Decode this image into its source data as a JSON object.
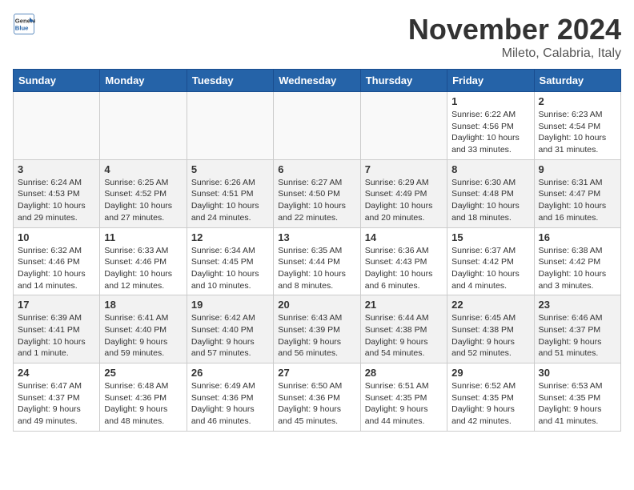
{
  "header": {
    "logo_line1": "General",
    "logo_line2": "Blue",
    "month_title": "November 2024",
    "location": "Mileto, Calabria, Italy"
  },
  "weekdays": [
    "Sunday",
    "Monday",
    "Tuesday",
    "Wednesday",
    "Thursday",
    "Friday",
    "Saturday"
  ],
  "weeks": [
    [
      {
        "day": "",
        "info": ""
      },
      {
        "day": "",
        "info": ""
      },
      {
        "day": "",
        "info": ""
      },
      {
        "day": "",
        "info": ""
      },
      {
        "day": "",
        "info": ""
      },
      {
        "day": "1",
        "info": "Sunrise: 6:22 AM\nSunset: 4:56 PM\nDaylight: 10 hours and 33 minutes."
      },
      {
        "day": "2",
        "info": "Sunrise: 6:23 AM\nSunset: 4:54 PM\nDaylight: 10 hours and 31 minutes."
      }
    ],
    [
      {
        "day": "3",
        "info": "Sunrise: 6:24 AM\nSunset: 4:53 PM\nDaylight: 10 hours and 29 minutes."
      },
      {
        "day": "4",
        "info": "Sunrise: 6:25 AM\nSunset: 4:52 PM\nDaylight: 10 hours and 27 minutes."
      },
      {
        "day": "5",
        "info": "Sunrise: 6:26 AM\nSunset: 4:51 PM\nDaylight: 10 hours and 24 minutes."
      },
      {
        "day": "6",
        "info": "Sunrise: 6:27 AM\nSunset: 4:50 PM\nDaylight: 10 hours and 22 minutes."
      },
      {
        "day": "7",
        "info": "Sunrise: 6:29 AM\nSunset: 4:49 PM\nDaylight: 10 hours and 20 minutes."
      },
      {
        "day": "8",
        "info": "Sunrise: 6:30 AM\nSunset: 4:48 PM\nDaylight: 10 hours and 18 minutes."
      },
      {
        "day": "9",
        "info": "Sunrise: 6:31 AM\nSunset: 4:47 PM\nDaylight: 10 hours and 16 minutes."
      }
    ],
    [
      {
        "day": "10",
        "info": "Sunrise: 6:32 AM\nSunset: 4:46 PM\nDaylight: 10 hours and 14 minutes."
      },
      {
        "day": "11",
        "info": "Sunrise: 6:33 AM\nSunset: 4:46 PM\nDaylight: 10 hours and 12 minutes."
      },
      {
        "day": "12",
        "info": "Sunrise: 6:34 AM\nSunset: 4:45 PM\nDaylight: 10 hours and 10 minutes."
      },
      {
        "day": "13",
        "info": "Sunrise: 6:35 AM\nSunset: 4:44 PM\nDaylight: 10 hours and 8 minutes."
      },
      {
        "day": "14",
        "info": "Sunrise: 6:36 AM\nSunset: 4:43 PM\nDaylight: 10 hours and 6 minutes."
      },
      {
        "day": "15",
        "info": "Sunrise: 6:37 AM\nSunset: 4:42 PM\nDaylight: 10 hours and 4 minutes."
      },
      {
        "day": "16",
        "info": "Sunrise: 6:38 AM\nSunset: 4:42 PM\nDaylight: 10 hours and 3 minutes."
      }
    ],
    [
      {
        "day": "17",
        "info": "Sunrise: 6:39 AM\nSunset: 4:41 PM\nDaylight: 10 hours and 1 minute."
      },
      {
        "day": "18",
        "info": "Sunrise: 6:41 AM\nSunset: 4:40 PM\nDaylight: 9 hours and 59 minutes."
      },
      {
        "day": "19",
        "info": "Sunrise: 6:42 AM\nSunset: 4:40 PM\nDaylight: 9 hours and 57 minutes."
      },
      {
        "day": "20",
        "info": "Sunrise: 6:43 AM\nSunset: 4:39 PM\nDaylight: 9 hours and 56 minutes."
      },
      {
        "day": "21",
        "info": "Sunrise: 6:44 AM\nSunset: 4:38 PM\nDaylight: 9 hours and 54 minutes."
      },
      {
        "day": "22",
        "info": "Sunrise: 6:45 AM\nSunset: 4:38 PM\nDaylight: 9 hours and 52 minutes."
      },
      {
        "day": "23",
        "info": "Sunrise: 6:46 AM\nSunset: 4:37 PM\nDaylight: 9 hours and 51 minutes."
      }
    ],
    [
      {
        "day": "24",
        "info": "Sunrise: 6:47 AM\nSunset: 4:37 PM\nDaylight: 9 hours and 49 minutes."
      },
      {
        "day": "25",
        "info": "Sunrise: 6:48 AM\nSunset: 4:36 PM\nDaylight: 9 hours and 48 minutes."
      },
      {
        "day": "26",
        "info": "Sunrise: 6:49 AM\nSunset: 4:36 PM\nDaylight: 9 hours and 46 minutes."
      },
      {
        "day": "27",
        "info": "Sunrise: 6:50 AM\nSunset: 4:36 PM\nDaylight: 9 hours and 45 minutes."
      },
      {
        "day": "28",
        "info": "Sunrise: 6:51 AM\nSunset: 4:35 PM\nDaylight: 9 hours and 44 minutes."
      },
      {
        "day": "29",
        "info": "Sunrise: 6:52 AM\nSunset: 4:35 PM\nDaylight: 9 hours and 42 minutes."
      },
      {
        "day": "30",
        "info": "Sunrise: 6:53 AM\nSunset: 4:35 PM\nDaylight: 9 hours and 41 minutes."
      }
    ]
  ]
}
